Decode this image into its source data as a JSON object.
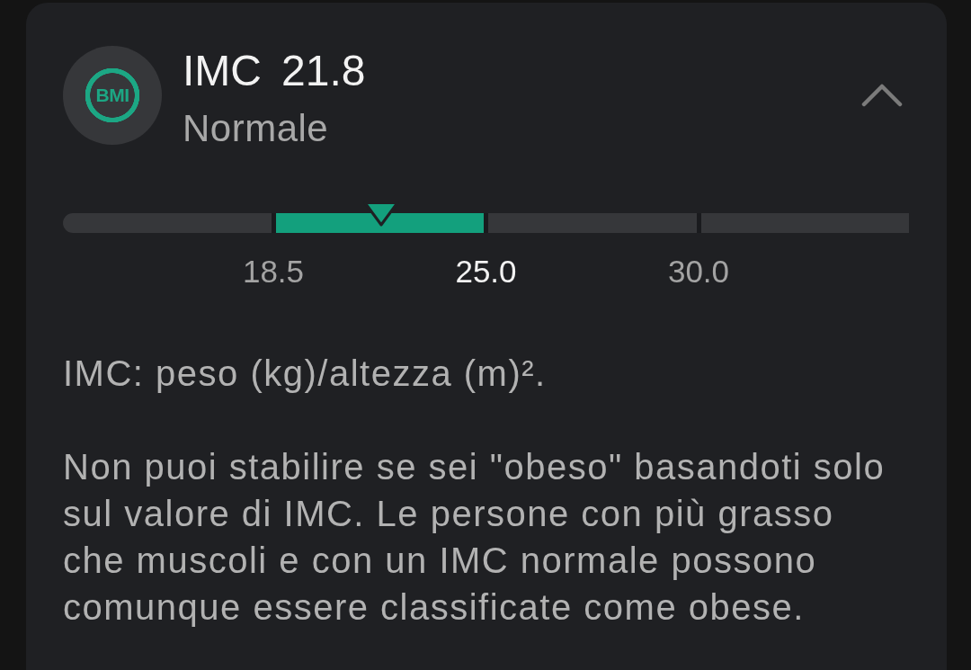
{
  "card": {
    "logo": "BMI",
    "title": {
      "label": "IMC",
      "value": "21.8"
    },
    "category": "Normale",
    "expanded": true,
    "scale": {
      "level": 0.376,
      "segments": [
        {
          "selected": false
        },
        {
          "selected": true
        },
        {
          "selected": false
        },
        {
          "selected": false
        }
      ],
      "ticks": [
        {
          "label": "18.5",
          "emphasized": false
        },
        {
          "label": "25.0",
          "emphasized": true
        },
        {
          "label": "30.0",
          "emphasized": false
        }
      ]
    },
    "formula": "IMC: peso (kg)/altezza (m)².",
    "note": "Non puoi stabilire se sei \"obeso\" basandoti solo sul valore di IMC. Le persone con più grasso che muscoli e con un IMC normale possono comunque essere classificate come obese."
  }
}
